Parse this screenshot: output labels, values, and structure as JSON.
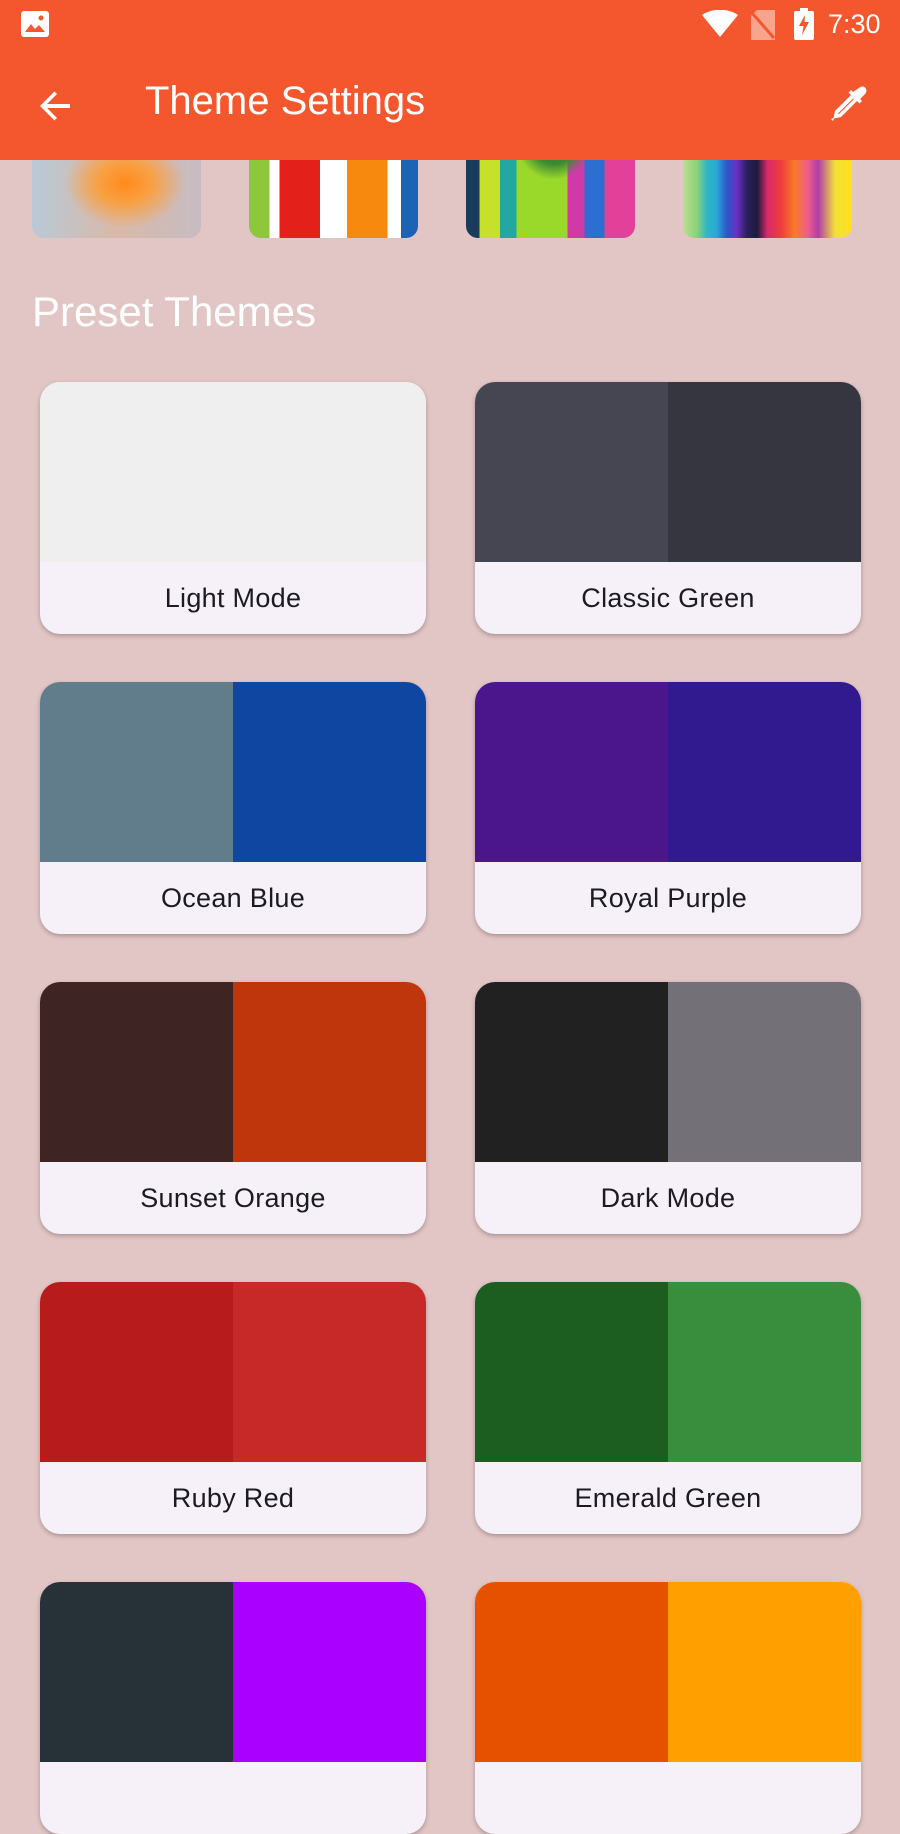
{
  "status_bar": {
    "time": "7:30",
    "icons": [
      "gallery-icon",
      "wifi-icon",
      "no-sim-icon",
      "battery-charging-icon"
    ]
  },
  "app_bar": {
    "title": "Theme Settings",
    "back_icon": "arrow-back-icon",
    "action_icon": "eyedropper-icon"
  },
  "wallpapers": {
    "items": [
      "blurred-orange-gradient",
      "paint-rollers",
      "colorful-street-with-tree",
      "rainbow-colonnade"
    ]
  },
  "presets": {
    "title": "Preset Themes",
    "themes": [
      {
        "label": "Light Mode",
        "colors": [
          "#efefef",
          "#efefef"
        ]
      },
      {
        "label": "Classic Green",
        "colors": [
          "#464653",
          "#363641"
        ]
      },
      {
        "label": "Ocean Blue",
        "colors": [
          "#617c8a",
          "#0f46a2"
        ]
      },
      {
        "label": "Royal Purple",
        "colors": [
          "#4b158b",
          "#311a8f"
        ]
      },
      {
        "label": "Sunset Orange",
        "colors": [
          "#3e2523",
          "#bf360c"
        ]
      },
      {
        "label": "Dark Mode",
        "colors": [
          "#212121",
          "#737077"
        ]
      },
      {
        "label": "Ruby Red",
        "colors": [
          "#b71b1c",
          "#c62928"
        ]
      },
      {
        "label": "Emerald Green",
        "colors": [
          "#1b5e20",
          "#388e3c"
        ]
      },
      {
        "label": "",
        "colors": [
          "#263238",
          "#aa00ff"
        ]
      },
      {
        "label": "",
        "colors": [
          "#e65100",
          "#ffa000"
        ]
      }
    ]
  },
  "colors": {
    "accent": "#f4572e",
    "background": "#e2c5c5",
    "card": "#f6f1f8",
    "label_text": "#1c1b20"
  }
}
